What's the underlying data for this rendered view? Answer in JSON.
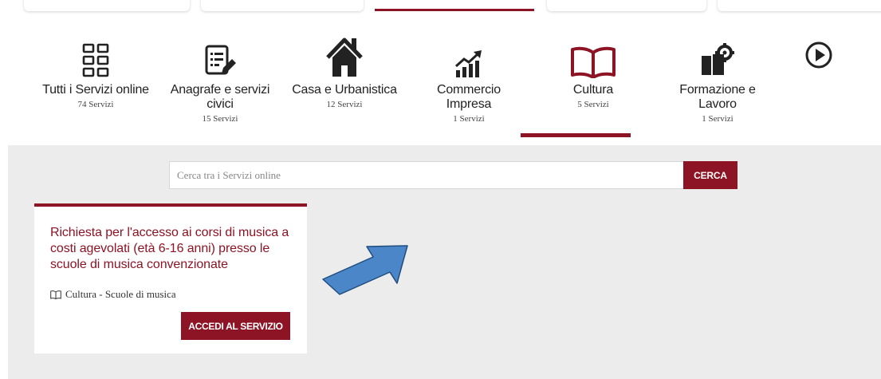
{
  "colors": {
    "accent": "#8c1424",
    "panel_bg": "#ececec"
  },
  "categories": [
    {
      "label": "Tutti i Servizi online",
      "count": "74 Servizi",
      "icon": "grid-icon"
    },
    {
      "label": "Anagrafe e servizi civici",
      "count": "15 Servizi",
      "icon": "document-edit-icon"
    },
    {
      "label": "Casa e Urbanistica",
      "count": "12 Servizi",
      "icon": "house-icon"
    },
    {
      "label": "Commercio Impresa",
      "count": "1 Servizi",
      "icon": "chart-up-icon"
    },
    {
      "label": "Cultura",
      "count": "5 Servizi",
      "icon": "book-icon",
      "active": true
    },
    {
      "label": "Formazione e Lavoro",
      "count": "1 Servizi",
      "icon": "book-gear-icon"
    }
  ],
  "search": {
    "placeholder": "Cerca tra i Servizi online",
    "button": "CERCA"
  },
  "card": {
    "title": "Richiesta per l'accesso ai corsi di musica a costi agevolati (età 6-16 anni) presso le scuole di musica convenzionate",
    "meta": "Cultura - Scuole di musica",
    "button": "ACCEDI AL SERVIZIO"
  }
}
